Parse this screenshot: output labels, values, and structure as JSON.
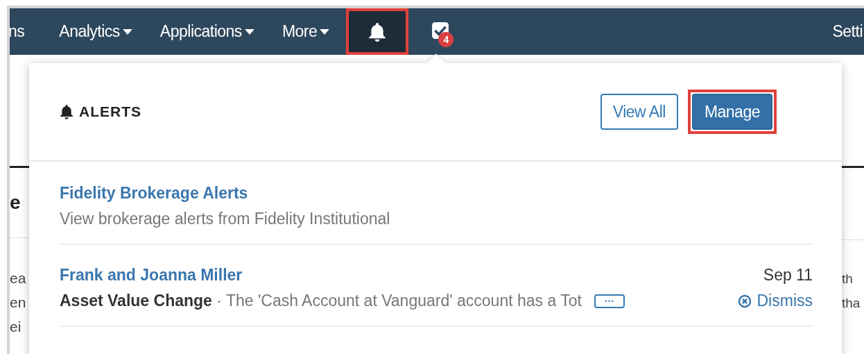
{
  "nav": {
    "items": [
      {
        "label": "ns",
        "dropdown": false
      },
      {
        "label": "Analytics",
        "dropdown": true
      },
      {
        "label": "Applications",
        "dropdown": true
      },
      {
        "label": "More",
        "dropdown": true
      }
    ],
    "alerts_button": {
      "selected": true,
      "highlighted": true
    },
    "tasks_button": {
      "badge": "4"
    },
    "right_item": "Setti"
  },
  "page": {
    "heading": "e",
    "left_lines": [
      "ea",
      "en",
      "ei"
    ],
    "right_lines": [
      "th",
      "tha"
    ]
  },
  "alerts_panel": {
    "title": "ALERTS",
    "buttons": [
      {
        "label": "View All",
        "kind": "outline",
        "highlighted": false
      },
      {
        "label": "Manage",
        "kind": "primary",
        "highlighted": true
      }
    ],
    "items": [
      {
        "title": "Fidelity Brokerage Alerts",
        "text": "View brokerage alerts from Fidelity Institutional"
      },
      {
        "title": "Frank and Joanna Miller",
        "text": "**Asset Value Change** · The 'Cash Account at Vanguard' account has a Tot",
        "date": "Sep 11",
        "more": "···",
        "dismiss": "Dismiss"
      }
    ]
  }
}
